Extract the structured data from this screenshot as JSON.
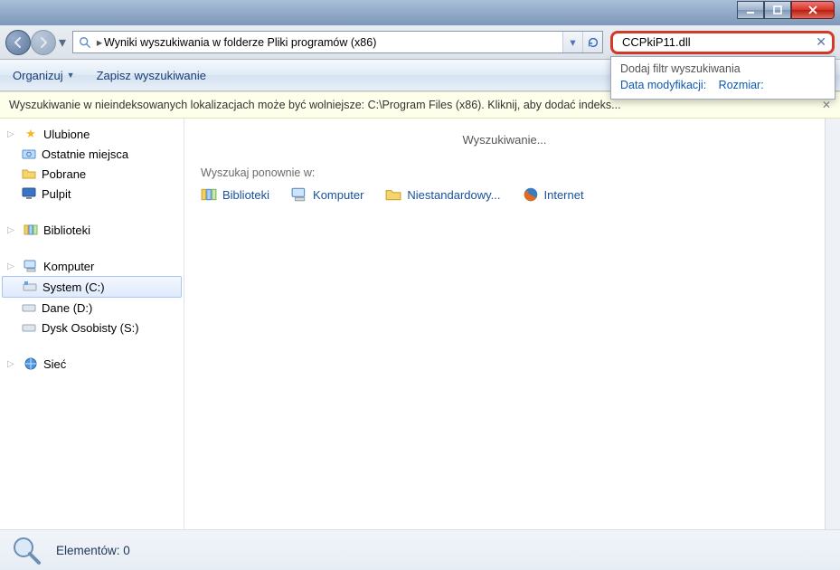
{
  "addressbar": {
    "text": "Wyniki wyszukiwania w folderze Pliki programów (x86)",
    "sep": "▸"
  },
  "search": {
    "value": "CCPkiP11.dll",
    "dropdown_header": "Dodaj filtr wyszukiwania",
    "filter_date": "Data modyfikacji:",
    "filter_size": "Rozmiar:"
  },
  "toolbar": {
    "organize": "Organizuj",
    "save_search": "Zapisz wyszukiwanie"
  },
  "infobar": {
    "text": "Wyszukiwanie w nieindeksowanych lokalizacjach może być wolniejsze: C:\\Program Files (x86). Kliknij, aby dodać indeks..."
  },
  "sidebar": {
    "favorites": "Ulubione",
    "recent": "Ostatnie miejsca",
    "downloads": "Pobrane",
    "desktop": "Pulpit",
    "libraries": "Biblioteki",
    "computer": "Komputer",
    "system_c": "System (C:)",
    "dane_d": "Dane (D:)",
    "personal_s": "Dysk Osobisty (S:)",
    "network": "Sieć"
  },
  "content": {
    "searching": "Wyszukiwanie...",
    "search_again_in": "Wyszukaj ponownie w:",
    "opt_libraries": "Biblioteki",
    "opt_computer": "Komputer",
    "opt_custom": "Niestandardowy...",
    "opt_internet": "Internet"
  },
  "statusbar": {
    "elements": "Elementów: 0"
  }
}
